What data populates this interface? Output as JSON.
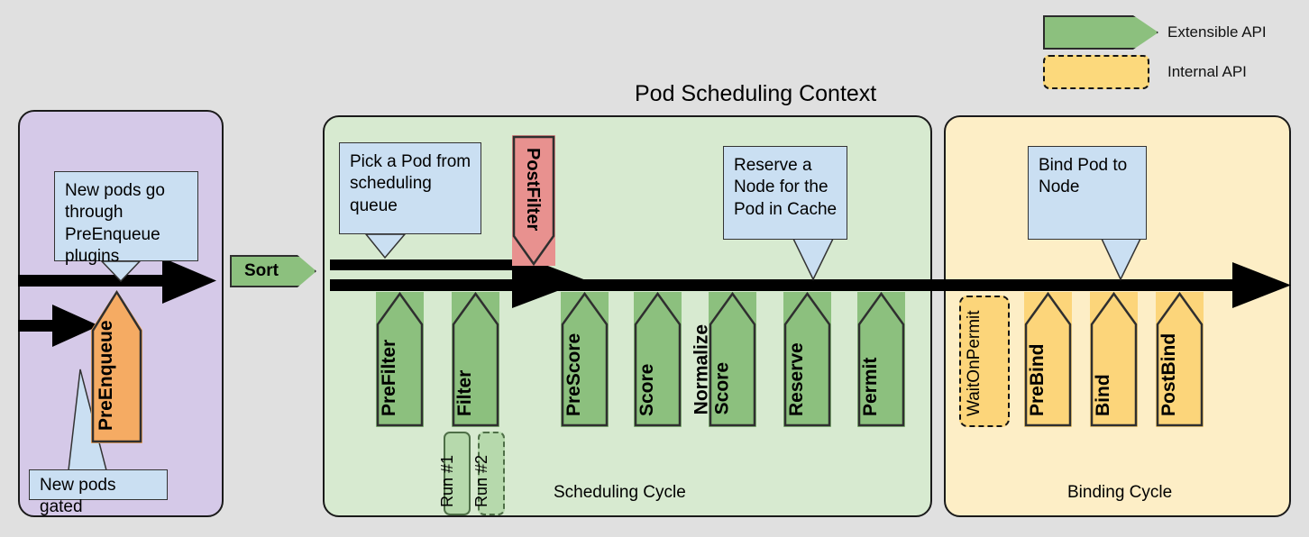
{
  "diagram": {
    "title": "Pod Scheduling Context",
    "background_color": "#e0e0e0"
  },
  "legend": {
    "items": [
      {
        "label": "Extensible API",
        "shape": "arrow",
        "color": "#8cc07e",
        "border": "solid"
      },
      {
        "label": "Internal API",
        "shape": "rounded-rect",
        "color": "#fcd97c",
        "border": "dashed"
      }
    ]
  },
  "queue_section": {
    "color": "#d5c9e8",
    "callout_top": "New pods go through PreEnqueue plugins",
    "callout_bottom": "New pods gated",
    "stage": {
      "label": "PreEnqueue",
      "color": "#f5ab63",
      "type": "extensible"
    }
  },
  "sort": {
    "label": "Sort",
    "color": "#8cc07e"
  },
  "scheduling_cycle": {
    "label": "Scheduling Cycle",
    "color": "#d7ead0",
    "callout_pick": "Pick a Pod from scheduling queue",
    "callout_reserve": "Reserve a Node for the Pod in Cache",
    "postfilter": {
      "label": "PostFilter",
      "color": "#e8918f"
    },
    "stages": [
      {
        "label": "PreFilter",
        "color": "#8cc07e"
      },
      {
        "label": "Filter",
        "color": "#8cc07e"
      },
      {
        "label": "PreScore",
        "color": "#8cc07e"
      },
      {
        "label": "Score",
        "color": "#8cc07e"
      },
      {
        "label": "Normalize Score",
        "line1": "Normalize",
        "line2": "Score",
        "color": "#8cc07e"
      },
      {
        "label": "Reserve",
        "color": "#8cc07e"
      },
      {
        "label": "Permit",
        "color": "#8cc07e"
      }
    ],
    "runs": [
      {
        "label": "Run #1",
        "border": "solid"
      },
      {
        "label": "Run #2",
        "border": "dashed"
      }
    ]
  },
  "binding_cycle": {
    "label": "Binding Cycle",
    "color": "#fdeec6",
    "callout_bind": "Bind Pod to Node",
    "wait_on_permit": {
      "label": "WaitOnPermit",
      "color": "#fcd57a",
      "type": "internal"
    },
    "stages": [
      {
        "label": "PreBind",
        "color": "#fcd57a"
      },
      {
        "label": "Bind",
        "color": "#fcd57a"
      },
      {
        "label": "PostBind",
        "color": "#fcd57a"
      }
    ]
  }
}
